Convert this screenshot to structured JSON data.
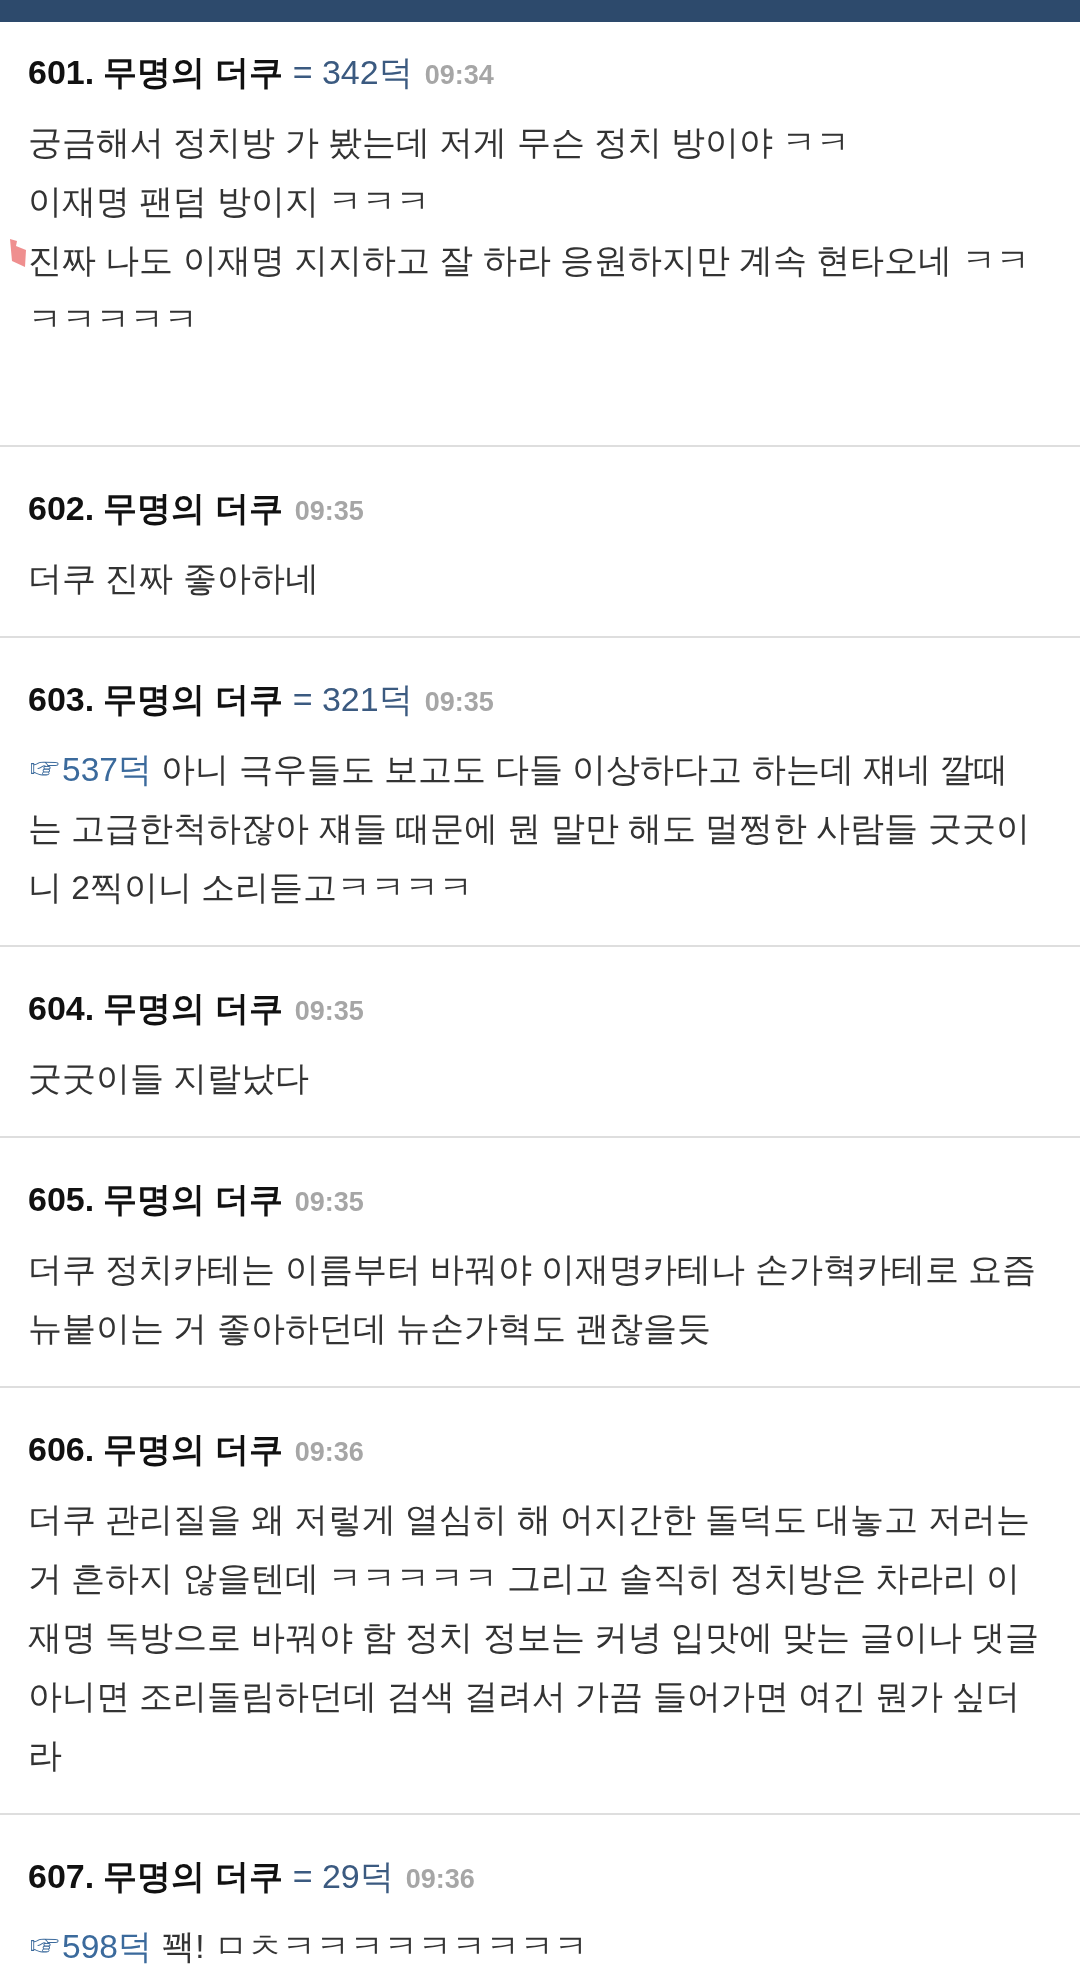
{
  "posts": [
    {
      "number": "601.",
      "author": "무명의 더쿠",
      "points": "= 342덕",
      "time": "09:34",
      "lines": [
        "궁금해서 정치방 가 봤는데 저게 무슨 정치 방이야 ㅋㅋ",
        "이재명 팬덤 방이지 ㅋㅋㅋ",
        "진짜 나도 이재명 지지하고 잘 하라 응원하지만 계속 현타오네 ㅋㅋ",
        "ㅋㅋㅋㅋㅋ"
      ]
    },
    {
      "number": "602.",
      "author": "무명의 더쿠",
      "time": "09:35",
      "lines": [
        "더쿠 진짜 좋아하네"
      ]
    },
    {
      "number": "603.",
      "author": "무명의 더쿠",
      "points": "= 321덕",
      "time": "09:35",
      "reply_to": "☞537덕",
      "lines": [
        "아니 극우들도 보고도 다들 이상하다고 하는데 쟤네 깔때",
        "는 고급한척하잖아 쟤들 때문에 뭔 말만 해도 멀쩡한 사람들 굿굿이",
        "니 2찍이니 소리듣고ㅋㅋㅋㅋ"
      ]
    },
    {
      "number": "604.",
      "author": "무명의 더쿠",
      "time": "09:35",
      "lines": [
        "굿굿이들 지랄났다"
      ]
    },
    {
      "number": "605.",
      "author": "무명의 더쿠",
      "time": "09:35",
      "lines": [
        "더쿠 정치카테는 이름부터 바꿔야 이재명카테나 손가혁카테로 요즘",
        "뉴붙이는 거 좋아하던데 뉴손가혁도 괜찮을듯"
      ]
    },
    {
      "number": "606.",
      "author": "무명의 더쿠",
      "time": "09:36",
      "lines": [
        "더쿠 관리질을 왜 저렇게 열심히 해 어지간한 돌덕도 대놓고 저러는",
        "거 흔하지 않을텐데 ㅋㅋㅋㅋㅋ 그리고 솔직히 정치방은 차라리 이",
        "재명 독방으로 바꿔야 함 정치 정보는 커녕 입맛에 맞는 글이나 댓글",
        "아니면 조리돌림하던데 검색 걸려서 가끔 들어가면 여긴 뭔가 싶더",
        "라"
      ]
    },
    {
      "number": "607.",
      "author": "무명의 더쿠",
      "points": "= 29덕",
      "time": "09:36",
      "reply_to": "☞598덕",
      "lines": [
        "꽥! ㅁㅊㅋㅋㅋㅋㅋㅋㅋㅋㅋ"
      ]
    }
  ]
}
